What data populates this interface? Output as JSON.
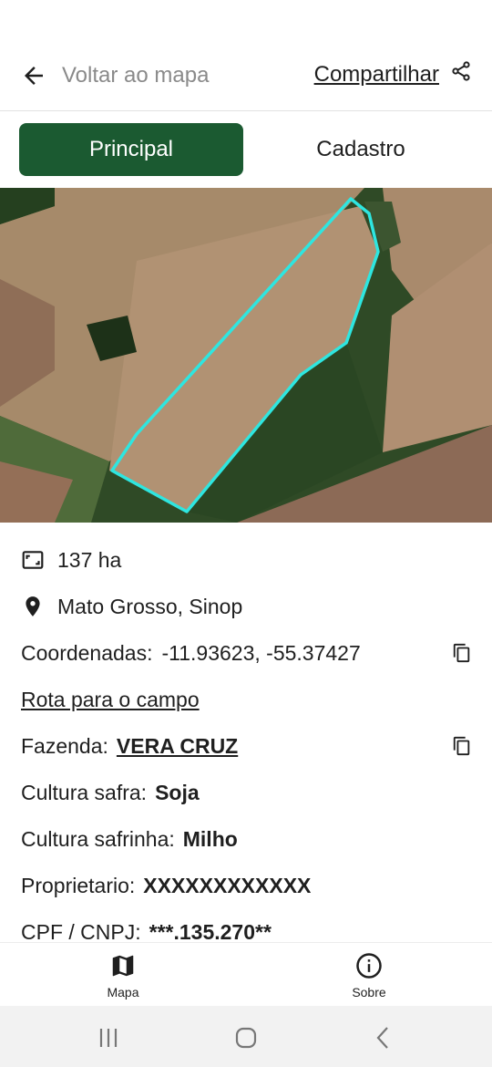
{
  "header": {
    "back_label": "Voltar ao mapa",
    "share_label": "Compartilhar"
  },
  "tabs": [
    {
      "label": "Principal",
      "active": true
    },
    {
      "label": "Cadastro",
      "active": false
    }
  ],
  "colors": {
    "primary_green": "#1b5a31",
    "boundary_outline": "#2ee6e0"
  },
  "details": {
    "area": "137 ha",
    "location": "Mato Grosso, Sinop",
    "coordinates_label": "Coordenadas:",
    "coordinates_value": "-11.93623, -55.37427",
    "route_link": "Rota para o campo",
    "farm_label": "Fazenda:",
    "farm_value": "VERA CRUZ",
    "crop_season_label": "Cultura safra:",
    "crop_season_value": "Soja",
    "crop_offseason_label": "Cultura safrinha:",
    "crop_offseason_value": "Milho",
    "owner_label": "Proprietario:",
    "owner_value": "XXXXXXXXXXXX",
    "doc_label": "CPF / CNPJ:",
    "doc_value": "***.135.270**"
  },
  "bottom_nav": [
    {
      "label": "Mapa",
      "icon": "map-icon"
    },
    {
      "label": "Sobre",
      "icon": "info-icon"
    }
  ],
  "system_nav": [
    "recents-icon",
    "home-icon",
    "back-icon"
  ]
}
